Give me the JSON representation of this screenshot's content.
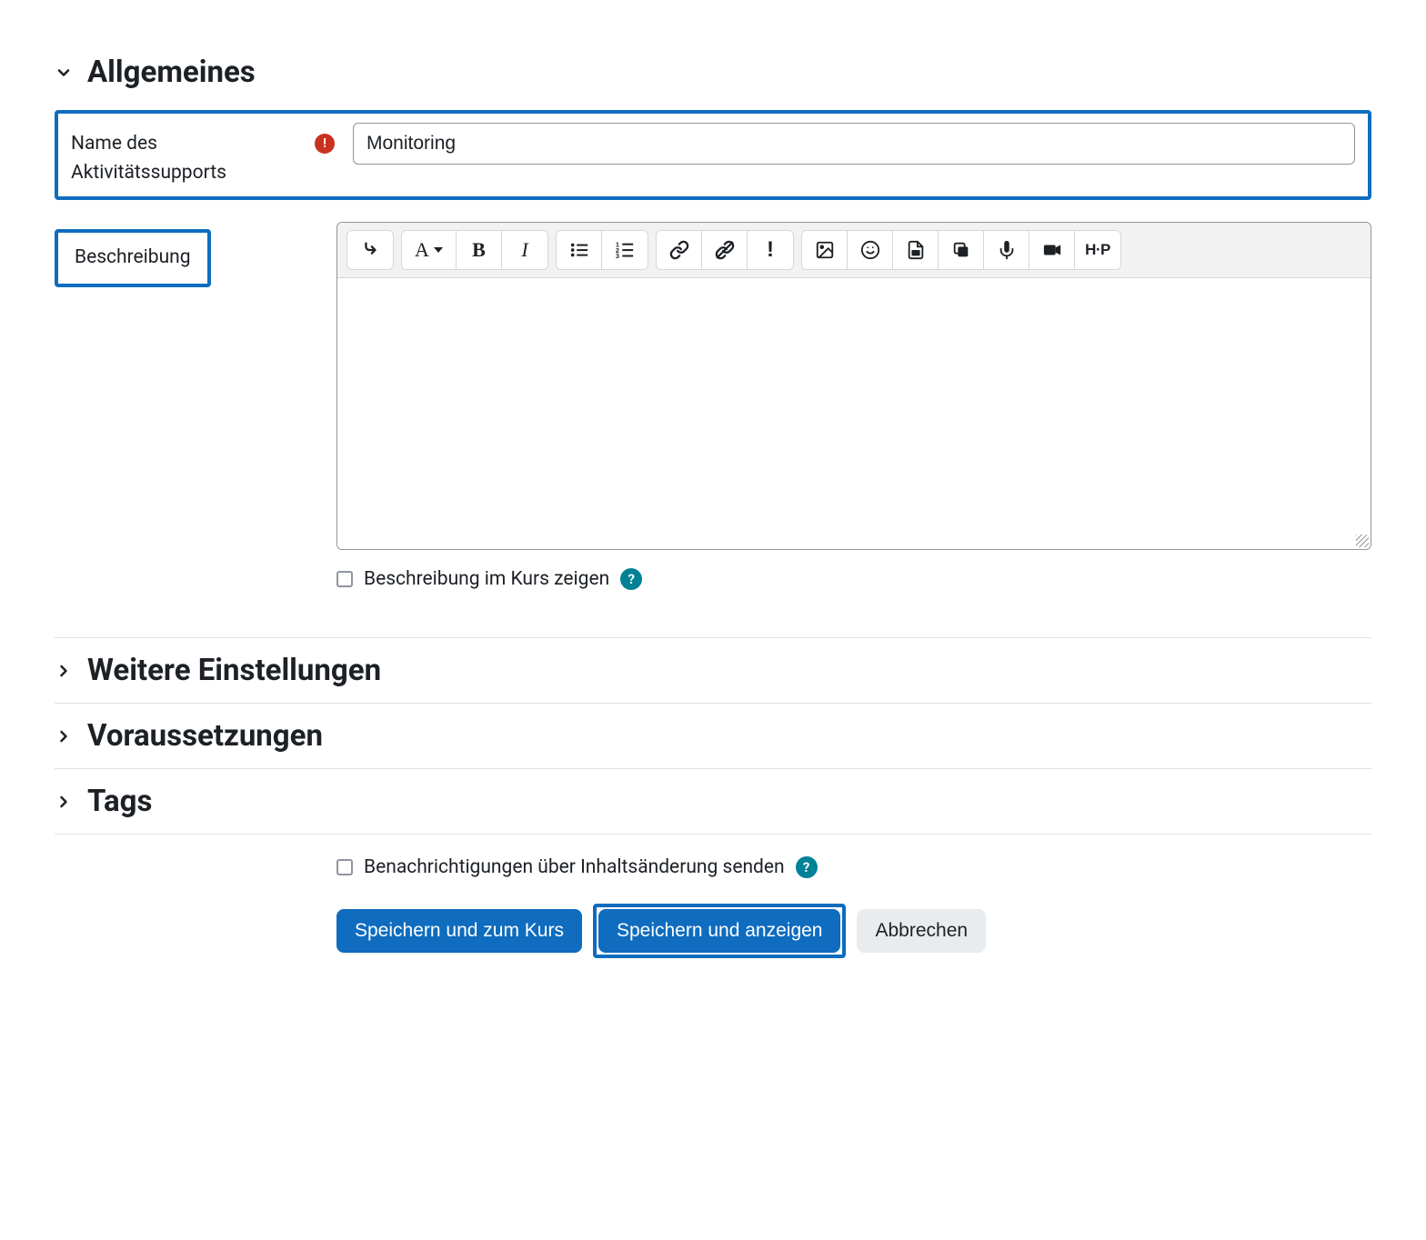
{
  "sections": {
    "general": {
      "title": "Allgemeines",
      "name_label": "Name des Aktivitätssupports",
      "name_value": "Monitoring",
      "description_label": "Beschreibung",
      "show_description_label": "Beschreibung im Kurs zeigen"
    },
    "further": {
      "title": "Weitere Einstellungen"
    },
    "prerequisites": {
      "title": "Voraussetzungen"
    },
    "tags": {
      "title": "Tags"
    }
  },
  "notify": {
    "label": "Benachrichtigungen über Inhaltsänderung senden"
  },
  "buttons": {
    "save_return": "Speichern und zum Kurs",
    "save_display": "Speichern und anzeigen",
    "cancel": "Abbrechen"
  },
  "icons": {
    "required": "!",
    "help": "?",
    "h5p": "H-P"
  }
}
